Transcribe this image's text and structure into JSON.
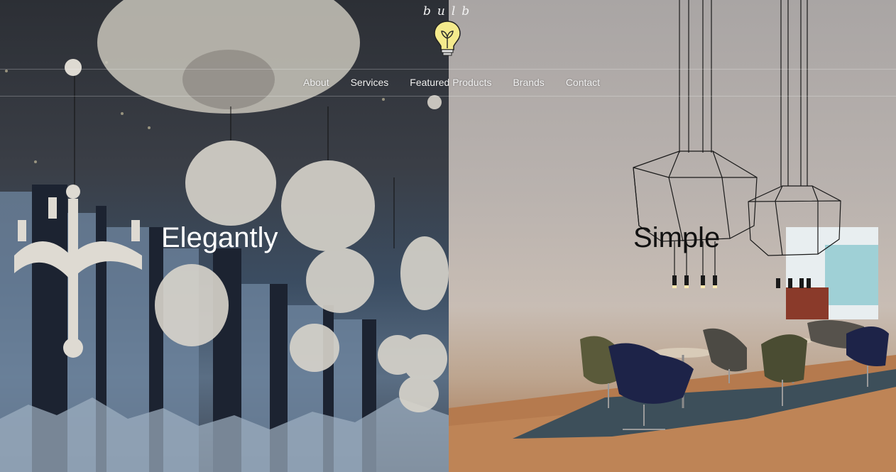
{
  "brand": {
    "name": "bulb",
    "logo_icon": "lightbulb-icon",
    "bulb_color": "#f4ea8c"
  },
  "nav": {
    "items": [
      {
        "label": "About"
      },
      {
        "label": "Services"
      },
      {
        "label": "Featured Products"
      },
      {
        "label": "Brands"
      },
      {
        "label": "Contact"
      }
    ]
  },
  "hero": {
    "left": {
      "headline": "Elegantly",
      "image": "dark-restaurant-pendant-lamps"
    },
    "right": {
      "headline": "Simple",
      "image": "bright-lounge-wire-pendants"
    }
  },
  "colors": {
    "nav_text": "#f2f2f2",
    "headline_left": "#ffffff",
    "headline_right": "#111111"
  }
}
